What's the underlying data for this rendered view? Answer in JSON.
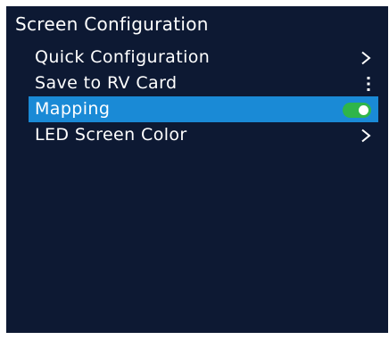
{
  "screen": {
    "title": "Screen Configuration"
  },
  "menu": {
    "items": [
      {
        "label": "Quick Configuration",
        "right_icon": "chevron-right-icon"
      },
      {
        "label": "Save to RV Card",
        "right_icon": "more-vertical-icon"
      },
      {
        "label": "Mapping",
        "right_icon": "toggle",
        "toggle_on": true,
        "selected": true
      },
      {
        "label": "LED Screen Color",
        "right_icon": "chevron-right-icon"
      }
    ]
  },
  "colors": {
    "background": "#0d1933",
    "selected_row": "#1a8ad6",
    "toggle_on": "#2fb54a",
    "text": "#ffffff"
  }
}
